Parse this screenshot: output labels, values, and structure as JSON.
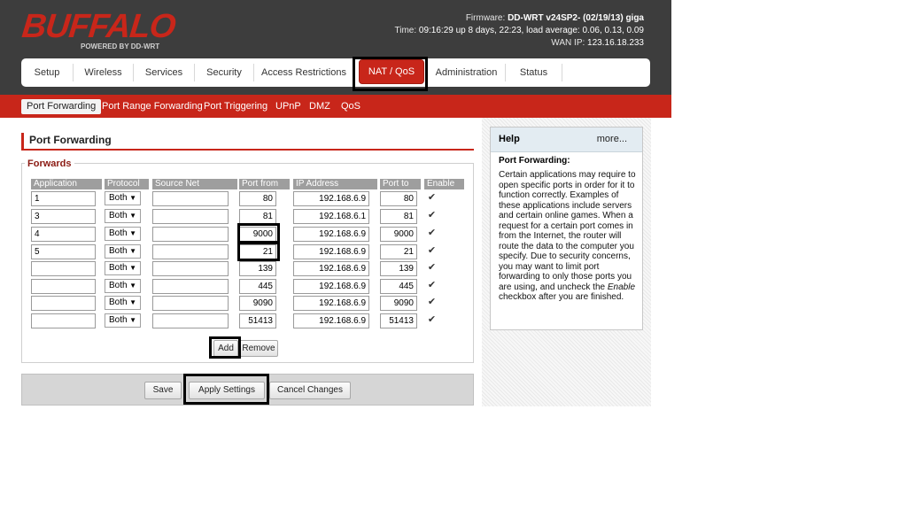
{
  "logo": {
    "brand": "BUFFALO",
    "tagline": "POWERED BY DD-WRT"
  },
  "info": {
    "firmware_label": "Firmware:",
    "firmware": "DD-WRT v24SP2- (02/19/13) giga",
    "time_label": "Time:",
    "time": "09:16:29 up 8 days, 22:23, load average: 0.06, 0.13, 0.09",
    "wan_label": "WAN IP:",
    "wan_ip": "123.16.18.233"
  },
  "nav": {
    "tabs": [
      "Setup",
      "Wireless",
      "Services",
      "Security",
      "Access Restrictions",
      "NAT / QoS",
      "Administration",
      "Status"
    ],
    "active": "NAT / QoS"
  },
  "subnav": {
    "items": [
      "Port Forwarding",
      "Port Range Forwarding",
      "Port Triggering",
      "UPnP",
      "DMZ",
      "QoS"
    ],
    "active": "Port Forwarding"
  },
  "page": {
    "title": "Port Forwarding",
    "legend": "Forwards"
  },
  "table": {
    "headers": [
      "Application",
      "Protocol",
      "Source Net",
      "Port from",
      "IP Address",
      "Port to",
      "Enable"
    ],
    "rows": [
      {
        "app": "1",
        "protocol": "Both",
        "source": "",
        "from": "80",
        "ip": "192.168.6.9",
        "to": "80",
        "enable": "✔"
      },
      {
        "app": "3",
        "protocol": "Both",
        "source": "",
        "from": "81",
        "ip": "192.168.6.1",
        "to": "81",
        "enable": "✔"
      },
      {
        "app": "4",
        "protocol": "Both",
        "source": "",
        "from": "9000",
        "ip": "192.168.6.9",
        "to": "9000",
        "enable": "✔"
      },
      {
        "app": "5",
        "protocol": "Both",
        "source": "",
        "from": "21",
        "ip": "192.168.6.9",
        "to": "21",
        "enable": "✔"
      },
      {
        "app": "",
        "protocol": "Both",
        "source": "",
        "from": "139",
        "ip": "192.168.6.9",
        "to": "139",
        "enable": "✔"
      },
      {
        "app": "",
        "protocol": "Both",
        "source": "",
        "from": "445",
        "ip": "192.168.6.9",
        "to": "445",
        "enable": "✔"
      },
      {
        "app": "",
        "protocol": "Both",
        "source": "",
        "from": "9090",
        "ip": "192.168.6.9",
        "to": "9090",
        "enable": "✔"
      },
      {
        "app": "",
        "protocol": "Both",
        "source": "",
        "from": "51413",
        "ip": "192.168.6.9",
        "to": "51413",
        "enable": "✔"
      }
    ],
    "dropdown_arrow": "▼"
  },
  "buttons": {
    "add": "Add",
    "remove": "Remove",
    "save": "Save",
    "apply": "Apply Settings",
    "cancel": "Cancel Changes"
  },
  "help": {
    "title": "Help",
    "more": "more...",
    "subtitle": "Port Forwarding:",
    "body_before": "Certain applications may require to open specific ports in order for it to function correctly. Examples of these applications include servers and certain online games. When a request for a certain port comes in from the Internet, the router will route the data to the computer you specify. Due to security concerns, you may want to limit port forwarding to only those ports you are using, and uncheck the ",
    "body_em": "Enable",
    "body_after": " checkbox after you are finished."
  },
  "colors": {
    "brand_red": "#c8261a",
    "header_bg": "#3d3d3d",
    "help_header": "#e3ecf2"
  }
}
